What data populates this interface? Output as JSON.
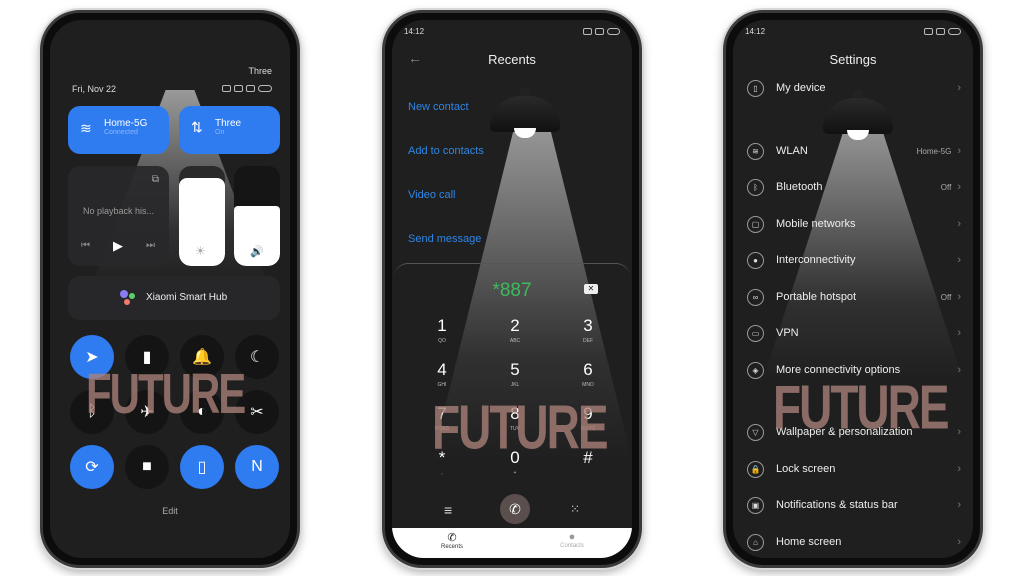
{
  "phone1": {
    "carrier": "Three",
    "date": "Fri, Nov 22",
    "wifi_tile": {
      "title": "Home-5G",
      "status": "Connected"
    },
    "data_tile": {
      "title": "Three",
      "status": "On"
    },
    "media": {
      "text": "No playback his..."
    },
    "brightness_level": 0.88,
    "volume_level": 0.6,
    "smart_hub_label": "Xiaomi Smart Hub",
    "toggles": [
      {
        "name": "location",
        "glyph": "➤",
        "on": true
      },
      {
        "name": "flashlight",
        "glyph": "▮",
        "on": false
      },
      {
        "name": "bell",
        "glyph": "🔔",
        "on": false
      },
      {
        "name": "dark-mode",
        "glyph": "☾",
        "on": false
      },
      {
        "name": "bluetooth",
        "glyph": "ᛒ",
        "on": false
      },
      {
        "name": "airplane",
        "glyph": "✈",
        "on": false
      },
      {
        "name": "reading-mode",
        "glyph": "◐",
        "on": false
      },
      {
        "name": "screenshot",
        "glyph": "✂",
        "on": false
      },
      {
        "name": "rotation-lock",
        "glyph": "⟳",
        "on": true
      },
      {
        "name": "screen-record",
        "glyph": "■",
        "on": false
      },
      {
        "name": "vibrate",
        "glyph": "▯",
        "on": true
      },
      {
        "name": "nfc",
        "glyph": "N",
        "on": true
      }
    ],
    "edit_label": "Edit"
  },
  "phone2": {
    "time": "14:12",
    "title": "Recents",
    "links": [
      "New contact",
      "Add to contacts",
      "Video call",
      "Send message"
    ],
    "dialed": "*887",
    "keys": [
      {
        "d": "1",
        "l": "QO"
      },
      {
        "d": "2",
        "l": "ABC"
      },
      {
        "d": "3",
        "l": "DEF"
      },
      {
        "d": "4",
        "l": "GHI"
      },
      {
        "d": "5",
        "l": "JKL"
      },
      {
        "d": "6",
        "l": "MNO"
      },
      {
        "d": "7",
        "l": "PQRS"
      },
      {
        "d": "8",
        "l": "TUV"
      },
      {
        "d": "9",
        "l": "WXYZ"
      },
      {
        "d": "*",
        "l": ","
      },
      {
        "d": "0",
        "l": "+"
      },
      {
        "d": "#",
        "l": ""
      }
    ],
    "tabs": [
      "Recents",
      "Contacts"
    ]
  },
  "phone3": {
    "time": "14:12",
    "title": "Settings",
    "items": [
      {
        "label": "My device",
        "value": "",
        "icon": "▯"
      },
      {
        "label": "WLAN",
        "value": "Home-5G",
        "icon": "≋"
      },
      {
        "label": "Bluetooth",
        "value": "Off",
        "icon": "ᛒ"
      },
      {
        "label": "Mobile networks",
        "value": "",
        "icon": "▢"
      },
      {
        "label": "Interconnectivity",
        "value": "",
        "icon": "●"
      },
      {
        "label": "Portable hotspot",
        "value": "Off",
        "icon": "∞"
      },
      {
        "label": "VPN",
        "value": "",
        "icon": "▭"
      },
      {
        "label": "More connectivity options",
        "value": "",
        "icon": "◈"
      },
      {
        "label": "Wallpaper & personalization",
        "value": "",
        "icon": "▽"
      },
      {
        "label": "Lock screen",
        "value": "",
        "icon": "🔒"
      },
      {
        "label": "Notifications & status bar",
        "value": "",
        "icon": "▣"
      },
      {
        "label": "Home screen",
        "value": "",
        "icon": "⌂"
      }
    ]
  },
  "watermark": "FUTURE",
  "colors": {
    "accent": "#2f7bf0",
    "link": "#2f86e6",
    "dialed": "#3dbb5c"
  }
}
